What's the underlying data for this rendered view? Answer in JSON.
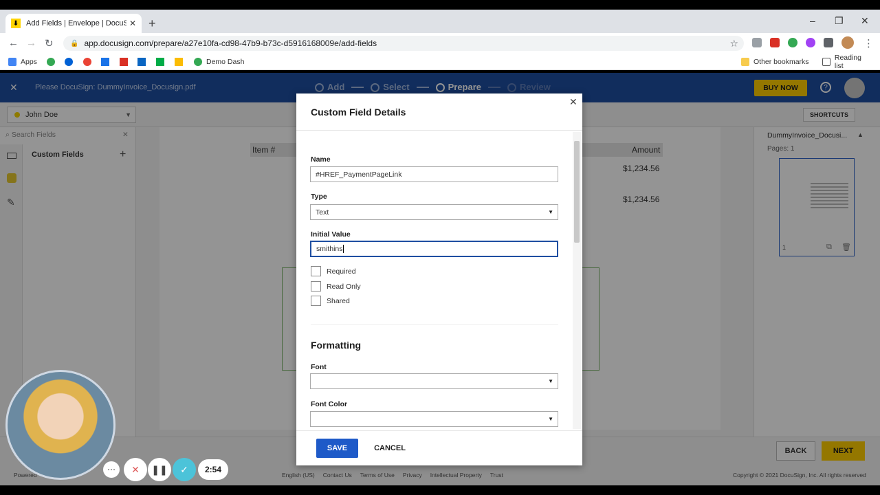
{
  "browser": {
    "tab_title": "Add Fields | Envelope | DocuSign",
    "url": "app.docusign.com/prepare/a27e10fa-cd98-47b9-b73c-d5916168009e/add-fields",
    "bookmarks": [
      "Apps",
      "Demo Dash"
    ],
    "other_bookmarks": "Other bookmarks",
    "reading_list": "Reading list"
  },
  "header": {
    "file_name": "Please DocuSign: DummyInvoice_Docusign.pdf",
    "steps": [
      "Add",
      "Select",
      "Prepare",
      "Review"
    ],
    "buy_now": "BUY NOW"
  },
  "toolbar": {
    "recipient": "John Doe",
    "shortcuts": "SHORTCUTS"
  },
  "left_panel": {
    "search_placeholder": "Search Fields",
    "section": "Custom Fields"
  },
  "document": {
    "col_item": "Item #",
    "col_amount": "Amount",
    "amounts": [
      "$1,234.56",
      "$1,234.56"
    ]
  },
  "right_panel": {
    "doc_name": "DummyInvoice_Docusi...",
    "pages": "Pages: 1",
    "page_number": "1"
  },
  "footer": {
    "back": "BACK",
    "next": "NEXT",
    "links": [
      "English (US)",
      "Contact Us",
      "Terms of Use",
      "Privacy",
      "Intellectual Property",
      "Trust"
    ],
    "copyright": "Copyright © 2021 DocuSign, Inc. All rights reserved",
    "powered": "Powered"
  },
  "modal": {
    "title": "Custom Field Details",
    "name_label": "Name",
    "name_value": "#HREF_PaymentPageLink",
    "type_label": "Type",
    "type_value": "Text",
    "initial_label": "Initial Value",
    "initial_value": "smithins",
    "checkbox_required": "Required",
    "checkbox_readonly": "Read Only",
    "checkbox_shared": "Shared",
    "formatting": "Formatting",
    "font_label": "Font",
    "font_color_label": "Font Color",
    "save": "SAVE",
    "cancel": "CANCEL"
  },
  "recorder": {
    "time": "2:54"
  },
  "colors": {
    "docusign_blue": "#1e4ea1",
    "buy_yellow": "#ffce00",
    "save_blue": "#1e5ac8"
  }
}
